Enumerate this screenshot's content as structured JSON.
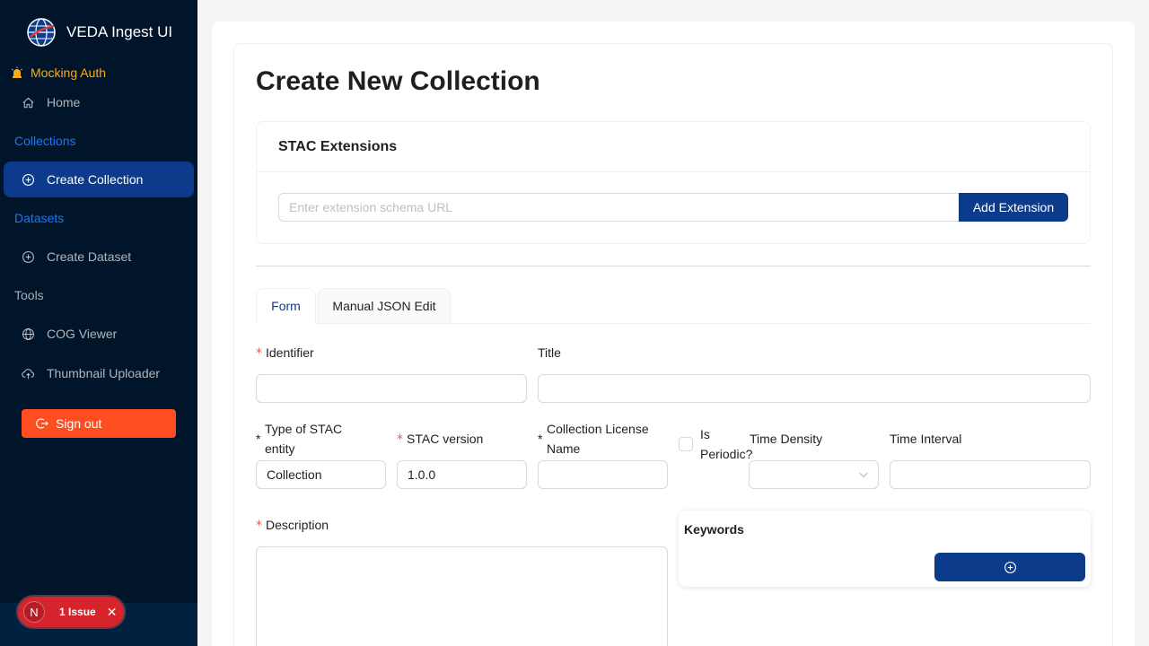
{
  "app": {
    "title": "VEDA Ingest UI",
    "auth_status": "Mocking Auth"
  },
  "sidebar": {
    "home": "Home",
    "collections_group": "Collections",
    "create_collection": "Create Collection",
    "datasets_group": "Datasets",
    "create_dataset": "Create Dataset",
    "tools_group": "Tools",
    "cog_viewer": "COG Viewer",
    "thumbnail_uploader": "Thumbnail Uploader",
    "sign_out": "Sign out"
  },
  "issues": {
    "avatar_letter": "N",
    "label": "1 Issue",
    "close": "✕"
  },
  "page": {
    "title": "Create New Collection"
  },
  "extensions": {
    "title": "STAC Extensions",
    "placeholder": "Enter extension schema URL",
    "add_button": "Add Extension"
  },
  "tabs": [
    {
      "label": "Form",
      "active": true
    },
    {
      "label": "Manual JSON Edit",
      "active": false
    }
  ],
  "form": {
    "required_mark": "*",
    "identifier_label": "Identifier",
    "identifier_value": "",
    "title_label": "Title",
    "title_value": "",
    "type_label_1": "Type of STAC",
    "type_label_2": "entity",
    "type_value": "Collection",
    "stac_version_label": "STAC version",
    "stac_version_value": "1.0.0",
    "license_label_1": "Collection License",
    "license_label_2": "Name",
    "license_value": "",
    "periodic_label_1": "Is",
    "periodic_label_2": "Periodic?",
    "periodic_checked": false,
    "time_density_label": "Time Density",
    "time_density_value": "",
    "time_interval_label": "Time Interval",
    "time_interval_value": "",
    "description_label": "Description",
    "description_value": "",
    "keywords_label": "Keywords"
  },
  "colors": {
    "primary": "#0d3b8c",
    "sidebar": "#001529",
    "danger": "#ff4d22",
    "required": "#ff4d4f",
    "warning": "#faad14"
  },
  "icons": [
    "globe-logo-icon",
    "alarm-icon",
    "home-icon",
    "plus-circle-icon",
    "globe-icon",
    "cloud-upload-icon",
    "logout-icon",
    "chevron-down-icon"
  ]
}
